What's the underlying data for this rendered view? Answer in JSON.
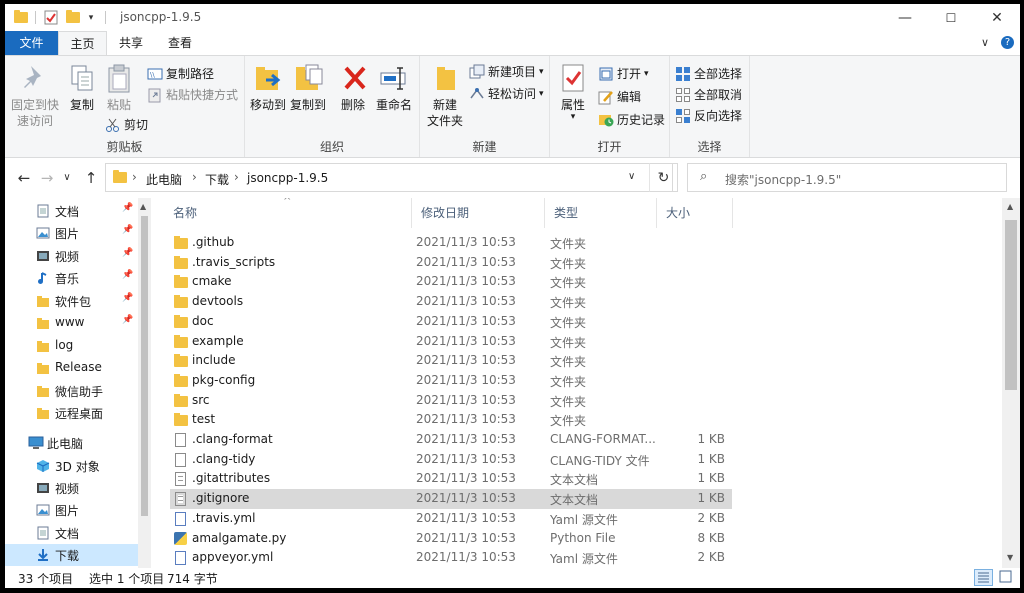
{
  "window": {
    "title": "jsoncpp-1.9.5",
    "controls": {
      "minimize": "—",
      "maximize": "☐",
      "close": "✕"
    }
  },
  "ribbon_tabs": [
    {
      "label": "文件"
    },
    {
      "label": "主页"
    },
    {
      "label": "共享"
    },
    {
      "label": "查看"
    }
  ],
  "ribbon_right": {
    "collapse": "∨",
    "help": "?"
  },
  "ribbon": {
    "clipboard": {
      "label": "剪贴板",
      "pin": "固定到快速访问",
      "pin_line1": "固定到快",
      "pin_line2": "速访问",
      "copy": "复制",
      "paste": "粘贴",
      "copy_path": "复制路径",
      "paste_shortcut": "粘贴快捷方式",
      "cut": "剪切"
    },
    "organize": {
      "label": "组织",
      "move_to": "移动到",
      "copy_to": "复制到",
      "delete": "删除",
      "rename": "重命名"
    },
    "new": {
      "label": "新建",
      "new_folder_line1": "新建",
      "new_folder_line2": "文件夹",
      "new_item": "新建项目",
      "easy_access": "轻松访问"
    },
    "open": {
      "label": "打开",
      "properties": "属性",
      "open": "打开",
      "edit": "编辑",
      "history": "历史记录"
    },
    "select": {
      "label": "选择",
      "select_all": "全部选择",
      "select_none": "全部取消",
      "invert": "反向选择"
    }
  },
  "address": {
    "back": "←",
    "forward": "→",
    "recent": "∨",
    "up": "↑",
    "crumbs": [
      "此电脑",
      "下载",
      "jsoncpp-1.9.5"
    ],
    "refresh": "↻",
    "search_placeholder": "搜索\"jsoncpp-1.9.5\""
  },
  "nav_pane": [
    {
      "label": "文档",
      "icon": "document-icon",
      "pinned": true
    },
    {
      "label": "图片",
      "icon": "picture-icon",
      "pinned": true
    },
    {
      "label": "视频",
      "icon": "video-icon",
      "pinned": true
    },
    {
      "label": "音乐",
      "icon": "music-icon",
      "pinned": true
    },
    {
      "label": "软件包",
      "icon": "folder-icon",
      "pinned": true
    },
    {
      "label": "www",
      "icon": "folder-icon",
      "pinned": true
    },
    {
      "label": "log",
      "icon": "folder-icon",
      "pinned": false
    },
    {
      "label": "Release",
      "icon": "folder-icon",
      "pinned": false
    },
    {
      "label": "微信助手",
      "icon": "folder-icon",
      "pinned": false
    },
    {
      "label": "远程桌面",
      "icon": "folder-icon",
      "pinned": false
    },
    {
      "label": "此电脑",
      "icon": "computer-icon",
      "pinned": false,
      "section": true
    },
    {
      "label": "3D 对象",
      "icon": "cube-icon",
      "pinned": false
    },
    {
      "label": "视频",
      "icon": "video-icon",
      "pinned": false
    },
    {
      "label": "图片",
      "icon": "picture-icon",
      "pinned": false
    },
    {
      "label": "文档",
      "icon": "document-icon",
      "pinned": false
    },
    {
      "label": "下载",
      "icon": "download-icon",
      "pinned": false,
      "selected": true
    }
  ],
  "columns": {
    "name": "名称",
    "date": "修改日期",
    "type": "类型",
    "size": "大小"
  },
  "files": [
    {
      "name": ".github",
      "date": "2021/11/3 10:53",
      "type": "文件夹",
      "size": "",
      "icon": "folder"
    },
    {
      "name": ".travis_scripts",
      "date": "2021/11/3 10:53",
      "type": "文件夹",
      "size": "",
      "icon": "folder"
    },
    {
      "name": "cmake",
      "date": "2021/11/3 10:53",
      "type": "文件夹",
      "size": "",
      "icon": "folder"
    },
    {
      "name": "devtools",
      "date": "2021/11/3 10:53",
      "type": "文件夹",
      "size": "",
      "icon": "folder"
    },
    {
      "name": "doc",
      "date": "2021/11/3 10:53",
      "type": "文件夹",
      "size": "",
      "icon": "folder"
    },
    {
      "name": "example",
      "date": "2021/11/3 10:53",
      "type": "文件夹",
      "size": "",
      "icon": "folder"
    },
    {
      "name": "include",
      "date": "2021/11/3 10:53",
      "type": "文件夹",
      "size": "",
      "icon": "folder"
    },
    {
      "name": "pkg-config",
      "date": "2021/11/3 10:53",
      "type": "文件夹",
      "size": "",
      "icon": "folder"
    },
    {
      "name": "src",
      "date": "2021/11/3 10:53",
      "type": "文件夹",
      "size": "",
      "icon": "folder"
    },
    {
      "name": "test",
      "date": "2021/11/3 10:53",
      "type": "文件夹",
      "size": "",
      "icon": "folder"
    },
    {
      "name": ".clang-format",
      "date": "2021/11/3 10:53",
      "type": "CLANG-FORMAT...",
      "size": "1 KB",
      "icon": "doc"
    },
    {
      "name": ".clang-tidy",
      "date": "2021/11/3 10:53",
      "type": "CLANG-TIDY 文件",
      "size": "1 KB",
      "icon": "doc"
    },
    {
      "name": ".gitattributes",
      "date": "2021/11/3 10:53",
      "type": "文本文档",
      "size": "1 KB",
      "icon": "txt"
    },
    {
      "name": ".gitignore",
      "date": "2021/11/3 10:53",
      "type": "文本文档",
      "size": "1 KB",
      "icon": "txt",
      "selected": true
    },
    {
      "name": ".travis.yml",
      "date": "2021/11/3 10:53",
      "type": "Yaml 源文件",
      "size": "2 KB",
      "icon": "yml"
    },
    {
      "name": "amalgamate.py",
      "date": "2021/11/3 10:53",
      "type": "Python File",
      "size": "8 KB",
      "icon": "py"
    },
    {
      "name": "appveyor.yml",
      "date": "2021/11/3 10:53",
      "type": "Yaml 源文件",
      "size": "2 KB",
      "icon": "yml"
    }
  ],
  "status": {
    "count": "33 个项目",
    "selected": "选中 1 个项目",
    "size": "714 字节"
  }
}
